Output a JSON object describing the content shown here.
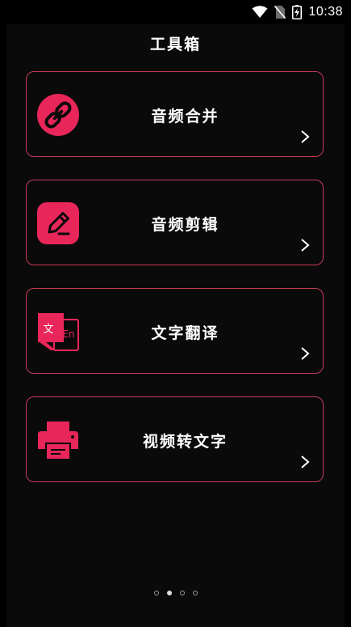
{
  "status_bar": {
    "time": "10:38",
    "icons": [
      "wifi-icon",
      "no-sim-icon",
      "battery-charging-icon"
    ]
  },
  "page": {
    "title": "工具箱"
  },
  "tools": [
    {
      "label": "音频合并",
      "icon": "link-icon"
    },
    {
      "label": "音频剪辑",
      "icon": "edit-pencil-icon"
    },
    {
      "label": "文字翻译",
      "icon": "translate-icon",
      "icon_text_left": "文",
      "icon_text_right": "En"
    },
    {
      "label": "视频转文字",
      "icon": "printer-icon"
    }
  ],
  "pager": {
    "count": 4,
    "active_index": 1
  },
  "colors": {
    "accent": "#e8265a",
    "card_border": "#c33a57",
    "background": "#0b0a0b",
    "text": "#ffffff"
  }
}
